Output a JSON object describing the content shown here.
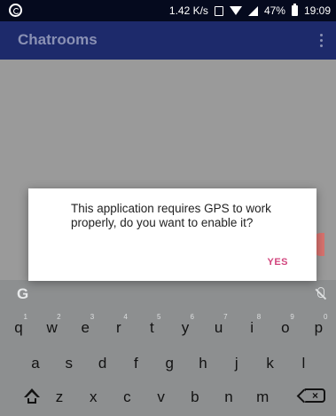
{
  "status_bar": {
    "speed": "1.42 K/s",
    "battery": "47%",
    "time": "19:09",
    "icons": [
      "whatsapp-icon",
      "screenshot-icon",
      "wifi-icon",
      "signal-icon",
      "battery-icon"
    ]
  },
  "toolbar": {
    "title": "Chatrooms",
    "menu_icon": "overflow-menu-icon"
  },
  "dialog": {
    "message": "This application requires GPS to work properly, do you want to enable it?",
    "positive_button": "YES"
  },
  "keyboard": {
    "rows": [
      [
        {
          "key": "q",
          "hint": "1"
        },
        {
          "key": "w",
          "hint": "2"
        },
        {
          "key": "e",
          "hint": "3"
        },
        {
          "key": "r",
          "hint": "4"
        },
        {
          "key": "t",
          "hint": "5"
        },
        {
          "key": "y",
          "hint": "6"
        },
        {
          "key": "u",
          "hint": "7"
        },
        {
          "key": "i",
          "hint": "8"
        },
        {
          "key": "o",
          "hint": "9"
        },
        {
          "key": "p",
          "hint": "0"
        }
      ],
      [
        {
          "key": "a"
        },
        {
          "key": "s"
        },
        {
          "key": "d"
        },
        {
          "key": "f"
        },
        {
          "key": "g"
        },
        {
          "key": "h"
        },
        {
          "key": "j"
        },
        {
          "key": "k"
        },
        {
          "key": "l"
        }
      ],
      [
        {
          "key": "z"
        },
        {
          "key": "x"
        },
        {
          "key": "c"
        },
        {
          "key": "v"
        },
        {
          "key": "b"
        },
        {
          "key": "n"
        },
        {
          "key": "m"
        }
      ]
    ]
  },
  "colors": {
    "toolbar": "#1d2a6b",
    "accent": "#d2467e",
    "scrim": "#9a9a9a",
    "keyboard": "#8d8f90"
  }
}
